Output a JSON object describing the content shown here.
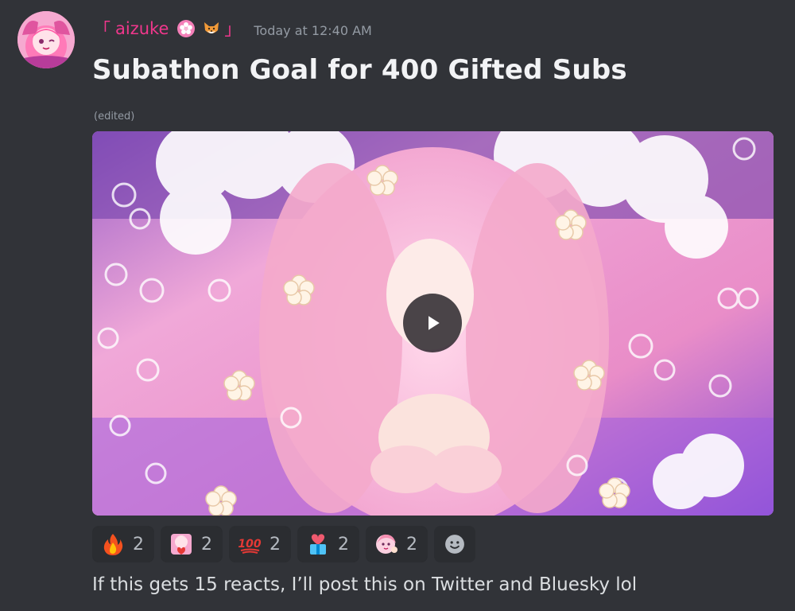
{
  "author": {
    "bracket_open": "「",
    "name": "aizuke",
    "bracket_close": "」",
    "badges": [
      "cherry-blossom-emoji",
      "fox-emoji"
    ],
    "name_color": "#f0378c"
  },
  "message": {
    "timestamp": "Today at 12:40 AM",
    "title": "Subathon Goal for 400 Gifted Subs",
    "edited_label": "(edited)",
    "content": "If this gets 15 reacts, I’ll post this on Twitter and Bluesky lol"
  },
  "attachment": {
    "type": "video",
    "icon": "play-icon"
  },
  "reactions": [
    {
      "emoji": "fire-emoji",
      "count": "2"
    },
    {
      "emoji": "anime-heart-emoji",
      "count": "2"
    },
    {
      "emoji": "hundred-points-emoji",
      "count": "2"
    },
    {
      "emoji": "heart-gift-emoji",
      "count": "2"
    },
    {
      "emoji": "anime-wave-emoji",
      "count": "2"
    }
  ],
  "add_reaction_icon": "smile-icon",
  "colors": {
    "background": "#313338",
    "reaction_bg": "#2b2d31",
    "timestamp": "#949ba4"
  }
}
